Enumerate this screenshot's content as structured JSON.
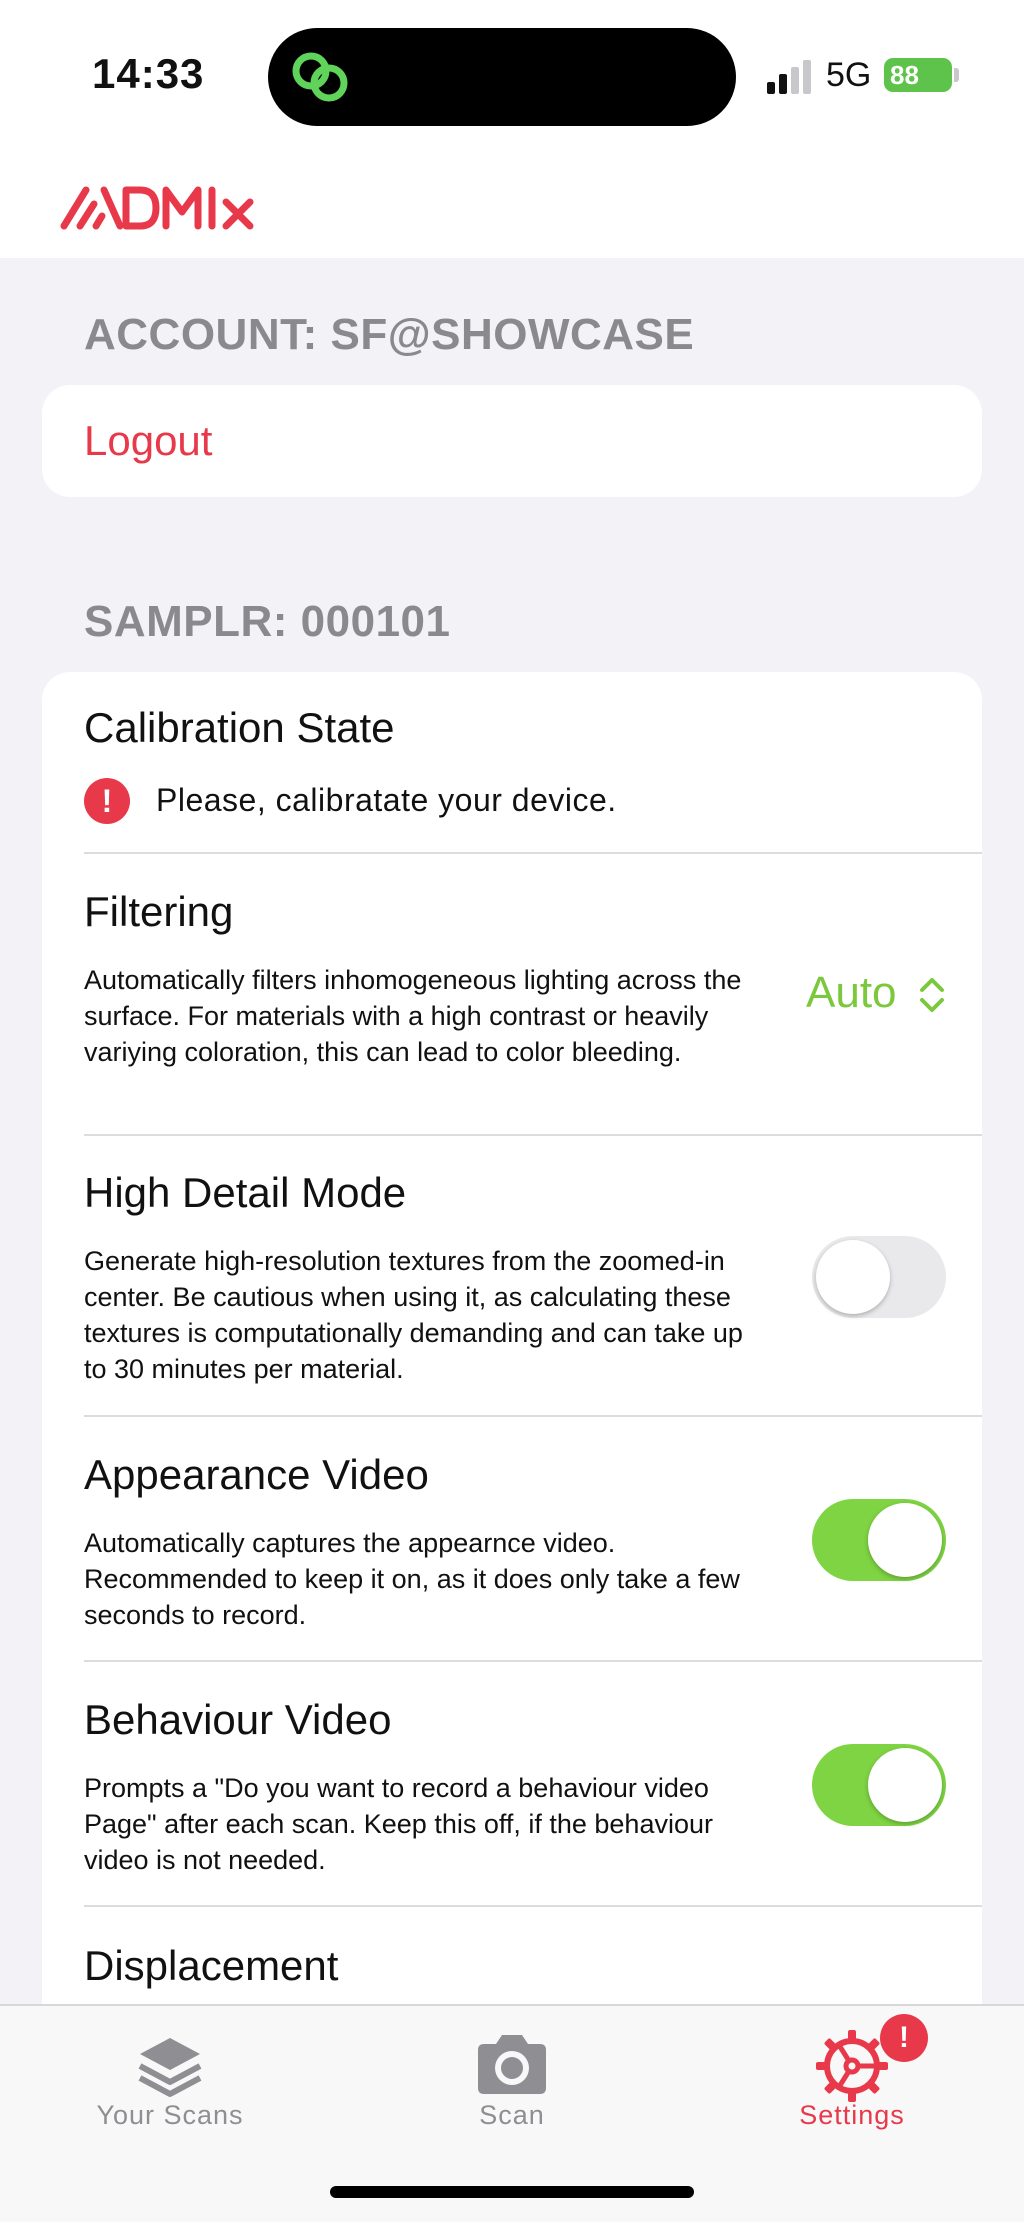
{
  "status_bar": {
    "time": "14:33",
    "network": "5G",
    "battery": "88"
  },
  "brand": {
    "logo_text": "DMIx"
  },
  "account": {
    "header": "ACCOUNT: SF@SHOWCASE",
    "logout_label": "Logout"
  },
  "sampler": {
    "header": "SAMPLR: 000101",
    "calibration": {
      "title": "Calibration State",
      "message": "Please, calibratate your device."
    },
    "filtering": {
      "title": "Filtering",
      "description": "Automatically filters inhomogeneous lighting across the surface. For materials with a high contrast or heavily variying coloration, this can lead to color bleeding.",
      "value": "Auto"
    },
    "high_detail": {
      "title": "High Detail Mode",
      "description": "Generate high-resolution textures from the zoomed-in center. Be cautious when using it, as calculating these textures is computationally demanding and can take up to 30 minutes per material.",
      "enabled": false
    },
    "appearance_video": {
      "title": "Appearance Video",
      "description": "Automatically captures the appearnce video. Recommended to keep it on, as it does only take a few seconds to record.",
      "enabled": true
    },
    "behaviour_video": {
      "title": "Behaviour Video",
      "description": "Prompts a \"Do you want to record a behaviour video Page\" after each scan. Keep this off, if the behaviour video is not needed.",
      "enabled": true
    },
    "displacement": {
      "title": "Displacement"
    }
  },
  "tabbar": {
    "tabs": [
      {
        "label": "Your Scans",
        "icon": "layers-icon",
        "active": false
      },
      {
        "label": "Scan",
        "icon": "camera-icon",
        "active": false
      },
      {
        "label": "Settings",
        "icon": "settings-gear-icon",
        "active": true
      }
    ],
    "settings_badge": "!"
  },
  "colors": {
    "accent": "#e8394b",
    "toggle_on": "#7ed442",
    "select_value": "#7bc83d",
    "inactive": "#8e8e93"
  }
}
